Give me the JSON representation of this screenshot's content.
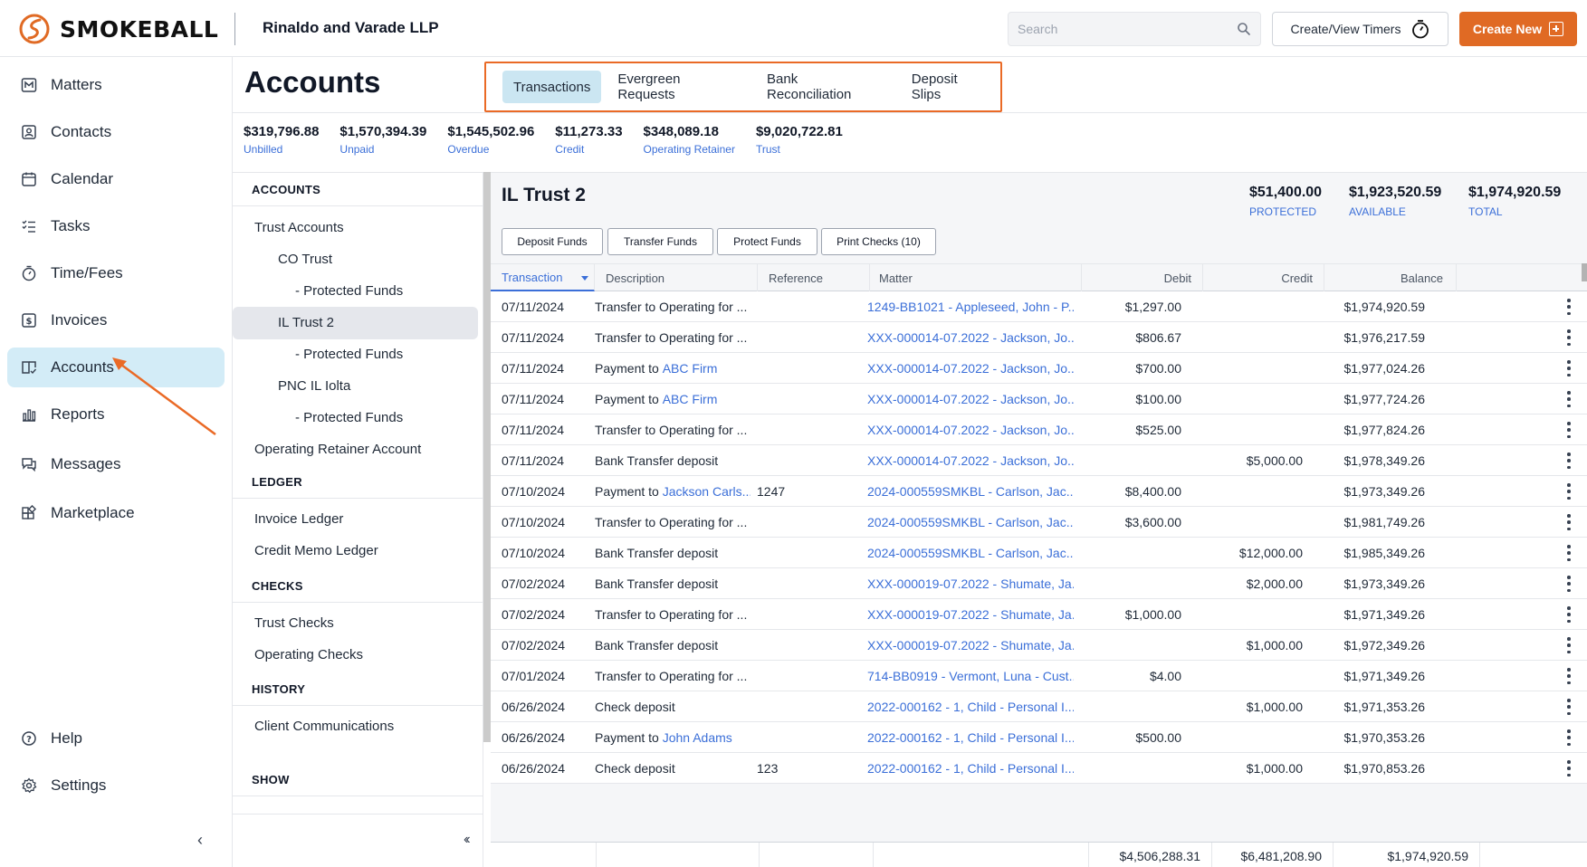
{
  "header": {
    "brand": "SMOKEBALL",
    "firm_name": "Rinaldo and Varade LLP",
    "search_placeholder": "Search",
    "timers_label": "Create/View Timers",
    "create_label": "Create New",
    "brand_color": "#e06a24"
  },
  "nav": {
    "items": [
      {
        "label": "Matters",
        "icon": "matters-icon"
      },
      {
        "label": "Contacts",
        "icon": "contacts-icon"
      },
      {
        "label": "Calendar",
        "icon": "calendar-icon"
      },
      {
        "label": "Tasks",
        "icon": "tasks-icon"
      },
      {
        "label": "Time/Fees",
        "icon": "stopwatch-icon"
      },
      {
        "label": "Invoices",
        "icon": "invoice-icon"
      },
      {
        "label": "Accounts",
        "icon": "accounts-icon",
        "active": true
      },
      {
        "label": "Reports",
        "icon": "reports-icon"
      },
      {
        "label": "Messages",
        "icon": "messages-icon"
      },
      {
        "label": "Marketplace",
        "icon": "marketplace-icon"
      }
    ],
    "help": "Help",
    "settings": "Settings",
    "collapse": "‹"
  },
  "page": {
    "title": "Accounts",
    "tabs": [
      "Transactions",
      "Evergreen Requests",
      "Bank Reconciliation",
      "Deposit Slips"
    ],
    "active_tab": "Transactions"
  },
  "summary": [
    {
      "amount": "$319,796.88",
      "label": "Unbilled"
    },
    {
      "amount": "$1,570,394.39",
      "label": "Unpaid"
    },
    {
      "amount": "$1,545,502.96",
      "label": "Overdue"
    },
    {
      "amount": "$11,273.33",
      "label": "Credit"
    },
    {
      "amount": "$348,089.18",
      "label": "Operating Retainer"
    },
    {
      "amount": "$9,020,722.81",
      "label": "Trust"
    }
  ],
  "accounts_panel": {
    "sections": {
      "accounts": "ACCOUNTS",
      "ledger": "LEDGER",
      "checks": "CHECKS",
      "history": "HISTORY",
      "show": "SHOW"
    },
    "trust_accounts": "Trust Accounts",
    "co_trust": "CO Trust",
    "protected_funds": "- Protected Funds",
    "il_trust_2": "IL Trust 2",
    "pnc": "PNC IL Iolta",
    "operating_retainer": "Operating Retainer Account",
    "invoice_ledger": "Invoice Ledger",
    "credit_memo_ledger": "Credit Memo Ledger",
    "trust_checks": "Trust Checks",
    "operating_checks": "Operating Checks",
    "client_communications": "Client Communications",
    "collapse": "‹‹"
  },
  "account": {
    "title": "IL Trust 2",
    "totals": [
      {
        "amount": "$51,400.00",
        "label": "PROTECTED"
      },
      {
        "amount": "$1,923,520.59",
        "label": "AVAILABLE"
      },
      {
        "amount": "$1,974,920.59",
        "label": "TOTAL"
      }
    ],
    "actions": [
      "Deposit Funds",
      "Transfer Funds",
      "Protect Funds",
      "Print Checks (10)"
    ]
  },
  "table": {
    "columns": [
      "Transaction",
      "Description",
      "Reference",
      "Matter",
      "Debit",
      "Credit",
      "Balance"
    ],
    "rows": [
      {
        "date": "07/11/2024",
        "desc": "Transfer to Operating for ...",
        "desc_link": "",
        "ref": "",
        "matter": "1249-BB1021 - Appleseed, John - P...",
        "debit": "$1,297.00",
        "credit": "",
        "balance": "$1,974,920.59"
      },
      {
        "date": "07/11/2024",
        "desc": "Transfer to Operating for ...",
        "desc_link": "",
        "ref": "",
        "matter": "XXX-000014-07.2022 - Jackson, Jo...",
        "debit": "$806.67",
        "credit": "",
        "balance": "$1,976,217.59"
      },
      {
        "date": "07/11/2024",
        "desc": "Payment to ",
        "desc_link": "ABC Firm",
        "ref": "",
        "matter": "XXX-000014-07.2022 - Jackson, Jo...",
        "debit": "$700.00",
        "credit": "",
        "balance": "$1,977,024.26"
      },
      {
        "date": "07/11/2024",
        "desc": "Payment to ",
        "desc_link": "ABC Firm",
        "ref": "",
        "matter": "XXX-000014-07.2022 - Jackson, Jo...",
        "debit": "$100.00",
        "credit": "",
        "balance": "$1,977,724.26"
      },
      {
        "date": "07/11/2024",
        "desc": "Transfer to Operating for ...",
        "desc_link": "",
        "ref": "",
        "matter": "XXX-000014-07.2022 - Jackson, Jo...",
        "debit": "$525.00",
        "credit": "",
        "balance": "$1,977,824.26"
      },
      {
        "date": "07/11/2024",
        "desc": "Bank Transfer deposit",
        "desc_link": "",
        "ref": "",
        "matter": "XXX-000014-07.2022 - Jackson, Jo...",
        "debit": "",
        "credit": "$5,000.00",
        "balance": "$1,978,349.26"
      },
      {
        "date": "07/10/2024",
        "desc": "Payment to ",
        "desc_link": "Jackson Carls...",
        "ref": "1247",
        "matter": "2024-000559SMKBL - Carlson, Jac...",
        "debit": "$8,400.00",
        "credit": "",
        "balance": "$1,973,349.26"
      },
      {
        "date": "07/10/2024",
        "desc": "Transfer to Operating for ...",
        "desc_link": "",
        "ref": "",
        "matter": "2024-000559SMKBL - Carlson, Jac...",
        "debit": "$3,600.00",
        "credit": "",
        "balance": "$1,981,749.26"
      },
      {
        "date": "07/10/2024",
        "desc": "Bank Transfer deposit",
        "desc_link": "",
        "ref": "",
        "matter": "2024-000559SMKBL - Carlson, Jac...",
        "debit": "",
        "credit": "$12,000.00",
        "balance": "$1,985,349.26"
      },
      {
        "date": "07/02/2024",
        "desc": "Bank Transfer deposit",
        "desc_link": "",
        "ref": "",
        "matter": "XXX-000019-07.2022 - Shumate, Ja...",
        "debit": "",
        "credit": "$2,000.00",
        "balance": "$1,973,349.26"
      },
      {
        "date": "07/02/2024",
        "desc": "Transfer to Operating for ...",
        "desc_link": "",
        "ref": "",
        "matter": "XXX-000019-07.2022 - Shumate, Ja...",
        "debit": "$1,000.00",
        "credit": "",
        "balance": "$1,971,349.26"
      },
      {
        "date": "07/02/2024",
        "desc": "Bank Transfer deposit",
        "desc_link": "",
        "ref": "",
        "matter": "XXX-000019-07.2022 - Shumate, Ja...",
        "debit": "",
        "credit": "$1,000.00",
        "balance": "$1,972,349.26"
      },
      {
        "date": "07/01/2024",
        "desc": "Transfer to Operating for ...",
        "desc_link": "",
        "ref": "",
        "matter": "714-BB0919 - Vermont, Luna - Cust...",
        "debit": "$4.00",
        "credit": "",
        "balance": "$1,971,349.26"
      },
      {
        "date": "06/26/2024",
        "desc": "Check deposit",
        "desc_link": "",
        "ref": "",
        "matter": "2022-000162 - 1, Child - Personal I...",
        "debit": "",
        "credit": "$1,000.00",
        "balance": "$1,971,353.26"
      },
      {
        "date": "06/26/2024",
        "desc": "Payment to ",
        "desc_link": "John Adams",
        "ref": "",
        "matter": "2022-000162 - 1, Child - Personal I...",
        "debit": "$500.00",
        "credit": "",
        "balance": "$1,970,353.26"
      },
      {
        "date": "06/26/2024",
        "desc": "Check deposit",
        "desc_link": "",
        "ref": "123",
        "matter": "2022-000162 - 1, Child - Personal I...",
        "debit": "",
        "credit": "$1,000.00",
        "balance": "$1,970,853.26"
      }
    ],
    "footer": {
      "debit": "$4,506,288.31",
      "credit": "$6,481,208.90",
      "balance": "$1,974,920.59"
    }
  }
}
